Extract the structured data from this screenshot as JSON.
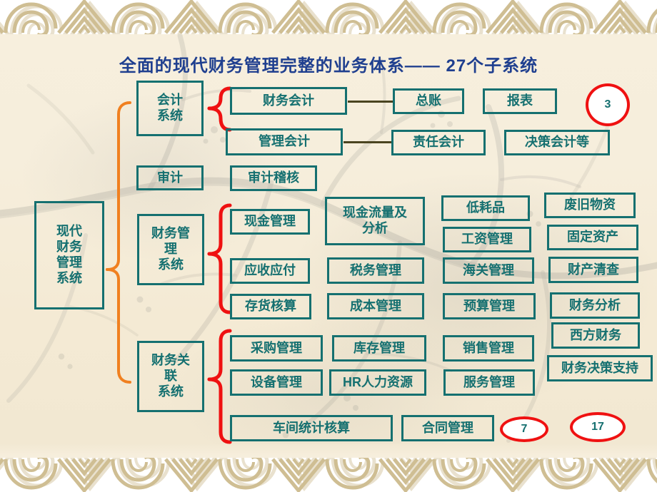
{
  "slide": {
    "title": "全面的现代财务管理完整的业务体系—— 27个子系统",
    "accent_teal": "#157070",
    "accent_red": "#ef1111",
    "accent_orange": "#f08020",
    "title_color": "#1f3f8f",
    "connector_color": "#4a4420",
    "paper_color": "#f5ecd9"
  },
  "root": {
    "label_lines": [
      "现代",
      "财务",
      "管理",
      "系统"
    ]
  },
  "groups": [
    {
      "id": "accounting",
      "label_lines": [
        "会计",
        "系统"
      ]
    },
    {
      "id": "audit",
      "label_lines": [
        "审计"
      ]
    },
    {
      "id": "finmgmt",
      "label_lines": [
        "财务管",
        "理",
        "系统"
      ]
    },
    {
      "id": "finrelated",
      "label_lines": [
        "财务关",
        "联",
        "系统"
      ]
    }
  ],
  "nodes": [
    {
      "id": "n01",
      "label": "财务会计"
    },
    {
      "id": "n02",
      "label": "总账"
    },
    {
      "id": "n03",
      "label": "报表"
    },
    {
      "id": "n04",
      "label": "管理会计"
    },
    {
      "id": "n05",
      "label": "责任会计"
    },
    {
      "id": "n06",
      "label": "决策会计等"
    },
    {
      "id": "n07",
      "label": "审计稽核"
    },
    {
      "id": "n08",
      "label": "现金管理"
    },
    {
      "id": "n09",
      "label": "现金流量及分析",
      "lines": [
        "现金流量及",
        "分析"
      ]
    },
    {
      "id": "n10",
      "label": "低耗品"
    },
    {
      "id": "n11",
      "label": "废旧物资"
    },
    {
      "id": "n12",
      "label": "工资管理"
    },
    {
      "id": "n13",
      "label": "固定资产"
    },
    {
      "id": "n14",
      "label": "应收应付"
    },
    {
      "id": "n15",
      "label": "税务管理"
    },
    {
      "id": "n16",
      "label": "海关管理"
    },
    {
      "id": "n17",
      "label": "财产清查"
    },
    {
      "id": "n18",
      "label": "存货核算"
    },
    {
      "id": "n19",
      "label": "成本管理"
    },
    {
      "id": "n20",
      "label": "预算管理"
    },
    {
      "id": "n21",
      "label": "财务分析"
    },
    {
      "id": "n22",
      "label": "采购管理"
    },
    {
      "id": "n23",
      "label": "库存管理"
    },
    {
      "id": "n24",
      "label": "销售管理"
    },
    {
      "id": "n25",
      "label": "西方财务"
    },
    {
      "id": "n26",
      "label": "设备管理"
    },
    {
      "id": "n27",
      "label": "HR人力资源"
    },
    {
      "id": "n28",
      "label": "服务管理"
    },
    {
      "id": "n29",
      "label": "财务决策支持"
    },
    {
      "id": "n30",
      "label": "车间统计核算"
    },
    {
      "id": "n31",
      "label": "合同管理"
    }
  ],
  "counters": [
    {
      "id": "c1",
      "value": "3"
    },
    {
      "id": "c2",
      "value": "7"
    },
    {
      "id": "c3",
      "value": "17"
    }
  ]
}
